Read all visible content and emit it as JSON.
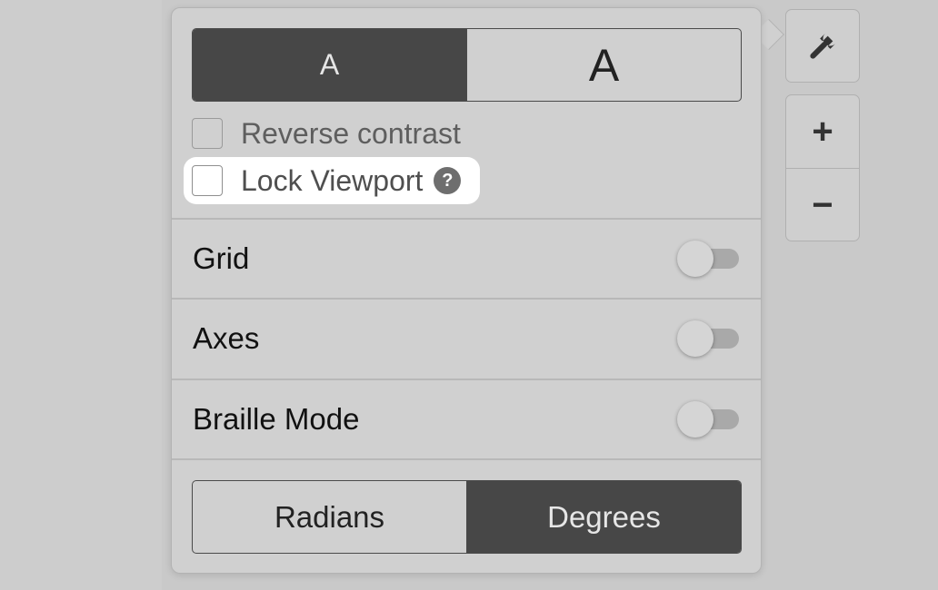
{
  "font_size": {
    "small_label": "A",
    "large_label": "A",
    "selected": "small"
  },
  "options": {
    "reverse_contrast": {
      "label": "Reverse contrast",
      "checked": false
    },
    "lock_viewport": {
      "label": "Lock Viewport",
      "checked": false,
      "help_glyph": "?"
    }
  },
  "toggles": [
    {
      "label": "Grid",
      "on": false
    },
    {
      "label": "Axes",
      "on": false
    },
    {
      "label": "Braille Mode",
      "on": false
    }
  ],
  "angle_mode": {
    "radians_label": "Radians",
    "degrees_label": "Degrees",
    "selected": "Degrees"
  },
  "toolbar": {
    "settings_icon": "wrench-icon",
    "zoom_in_label": "+",
    "zoom_out_label": "−"
  },
  "colors": {
    "active_segment": "#474747",
    "panel_bg": "#d0d0d0",
    "highlight": "#ffffff"
  }
}
